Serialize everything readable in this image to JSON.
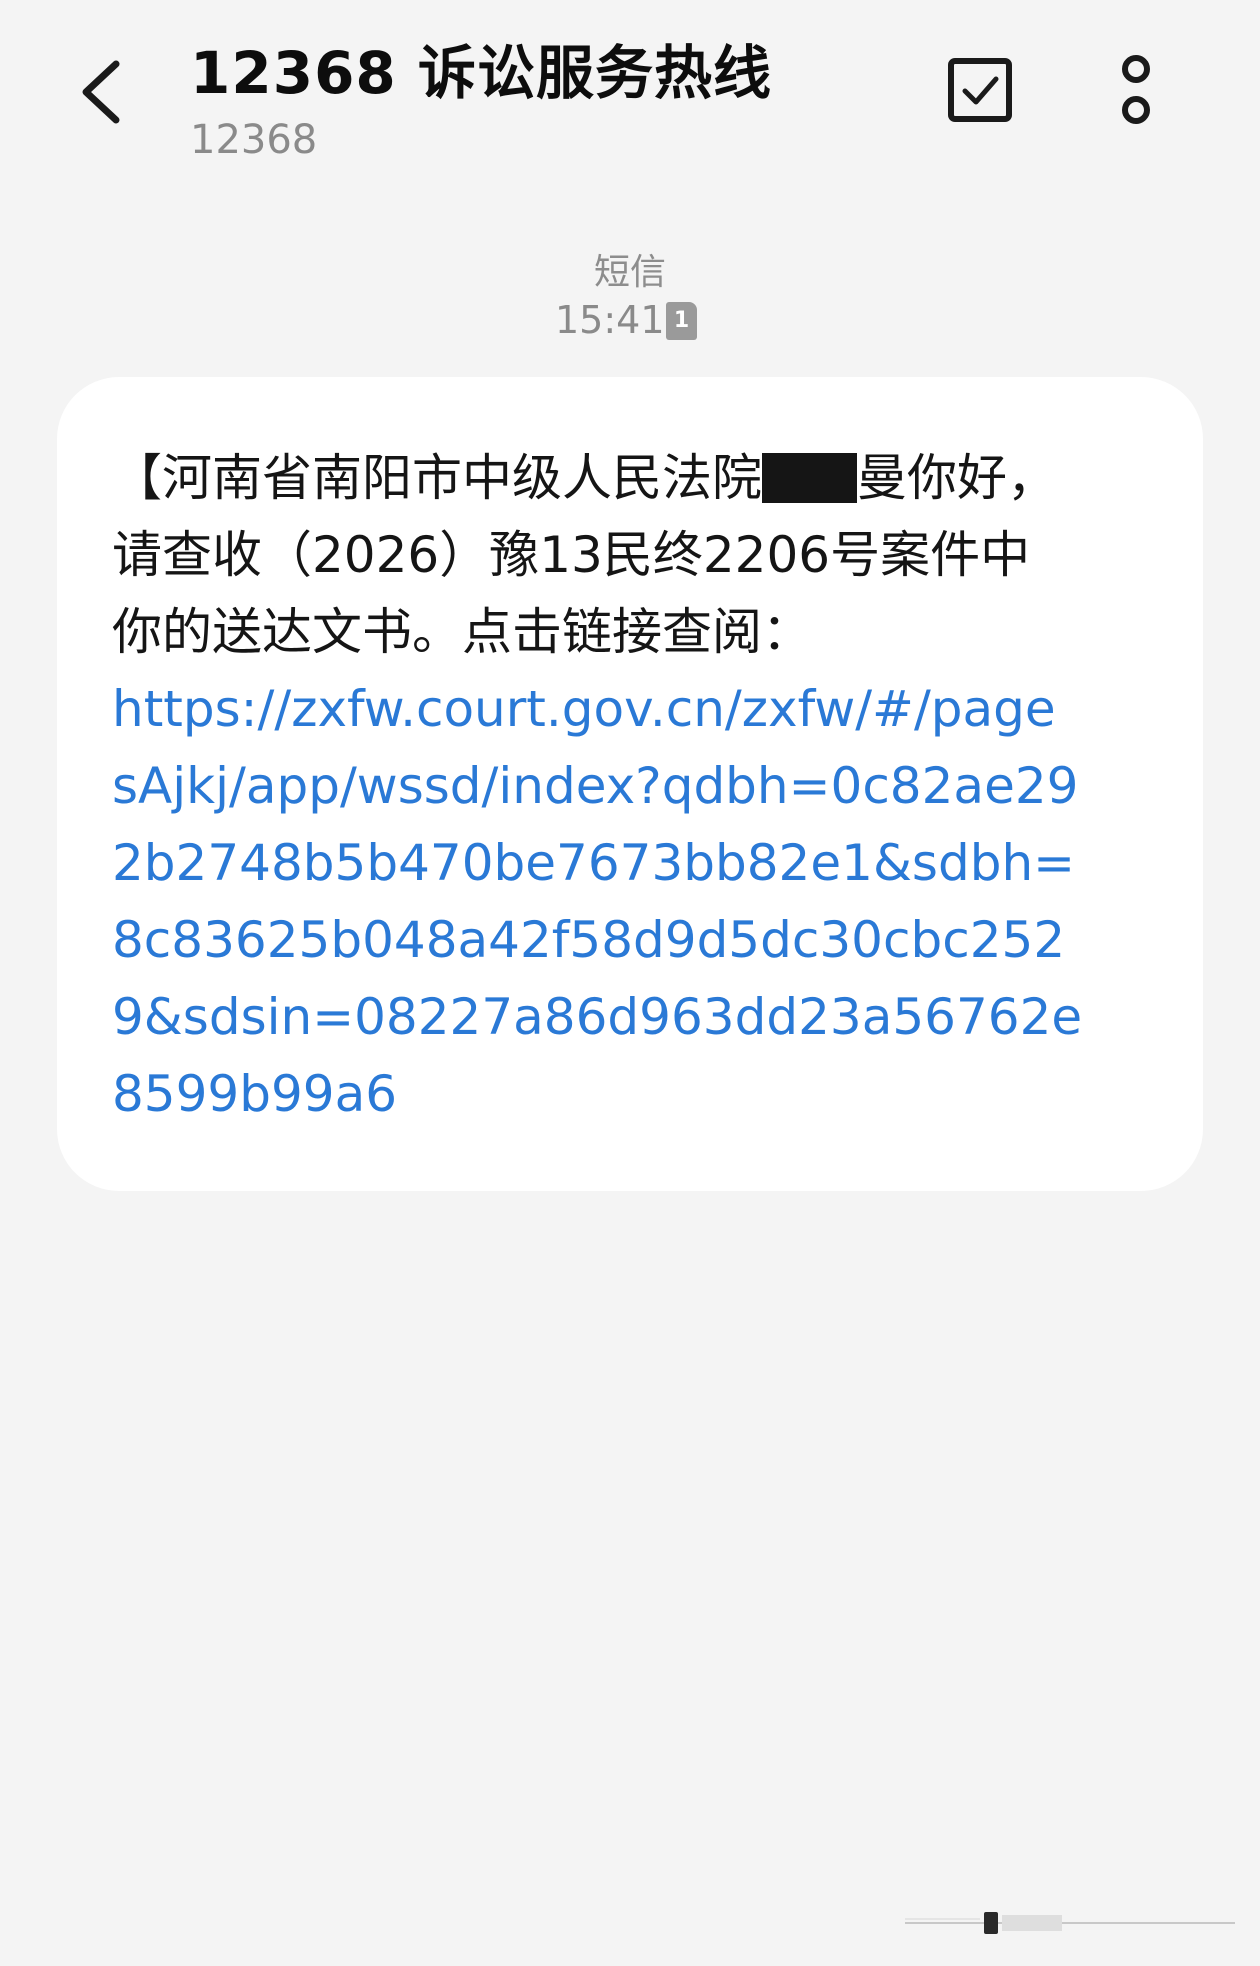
{
  "header": {
    "title": "12368 诉讼服务热线",
    "subtitle": "12368"
  },
  "meta": {
    "channel": "短信",
    "time": "15:41",
    "sim": "1"
  },
  "message": {
    "part1_before": "【河南省南阳市中级人民法院",
    "part1_after": "曼你好，",
    "line2": "请查收（2026）豫13民终2206号案件中",
    "line3": "你的送达文书。点击链接查阅：",
    "link_lines": [
      "https://zxfw.court.gov.cn/zxfw/#/page",
      "sAjkj/app/wssd/index?qdbh=0c82ae29",
      "2b2748b5b470be7673bb82e1&sdbh=",
      "8c83625b048a42f58d9d5dc30cbc252",
      "9&sdsin=08227a86d963dd23a56762e",
      "8599b99a6"
    ]
  },
  "icons": {
    "back": "back-arrow-icon",
    "select": "checkbox-icon",
    "more": "more-vertical-icon"
  }
}
